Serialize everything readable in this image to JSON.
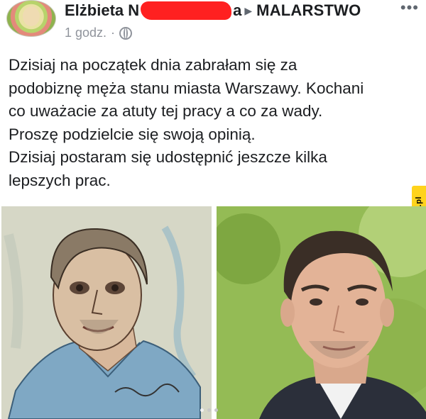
{
  "post": {
    "author_name": "Elżbieta N",
    "author_name_suffix": "a",
    "group_name": "MALARSTWO",
    "time": "1 godz.",
    "separator": "·",
    "more_icon": "more-dots-icon",
    "privacy_icon": "globe-icon",
    "text_lines": [
      "Dzisiaj na początek dnia zabrałam się za",
      "podobiznę męża stanu miasta Warszawy. Kochani",
      "co uważacie za atuty tej pracy a co za wady.",
      "Proszę podzielcie się swoją opinią.",
      "Dzisiaj postaram się udostępnić jeszcze kilka",
      "lepszych prac."
    ],
    "images": [
      {
        "name": "painting"
      },
      {
        "name": "photo"
      }
    ],
    "carousel": {
      "count": 3,
      "active": 1
    }
  },
  "watermark": {
    "text": "jeja.pl",
    "color": "#ffd31c"
  },
  "colors": {
    "text": "#1c1e21",
    "meta": "#90949c",
    "redaction": "#ff2020"
  }
}
